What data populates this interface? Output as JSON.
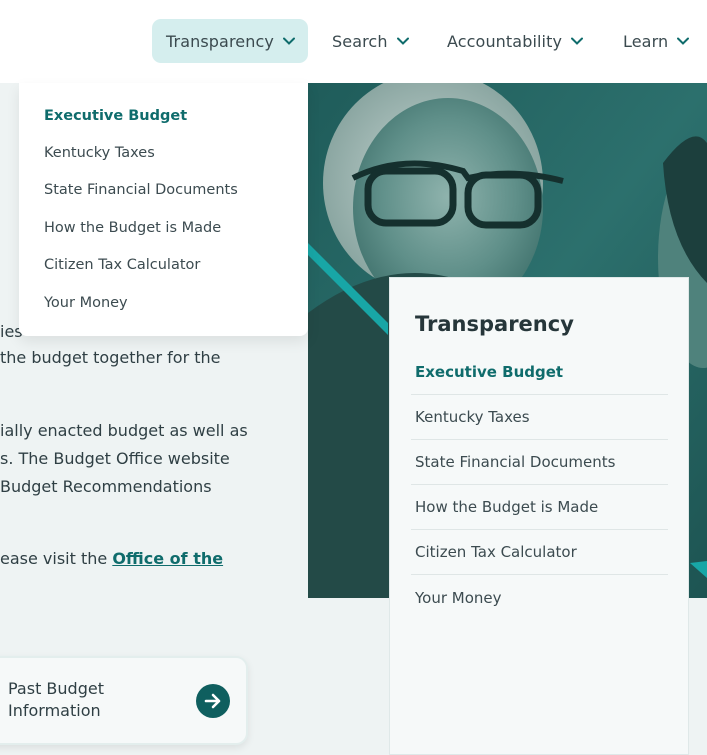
{
  "nav": {
    "items": [
      {
        "label": "Transparency",
        "active": true
      },
      {
        "label": "Search"
      },
      {
        "label": "Accountability"
      },
      {
        "label": "Learn"
      }
    ]
  },
  "dropdown": {
    "items": [
      {
        "label": "Executive Budget",
        "active": true
      },
      {
        "label": "Kentucky Taxes"
      },
      {
        "label": "State Financial Documents"
      },
      {
        "label": "How the Budget is Made"
      },
      {
        "label": "Citizen Tax Calculator"
      },
      {
        "label": "Your Money"
      }
    ]
  },
  "body": {
    "line1": "ies",
    "line2": " the budget together for the",
    "line3": "ially enacted budget as well as",
    "line4": "s. The Budget Office website",
    "line5": " Budget Recommendations",
    "line6_prefix": "ease visit the ",
    "line6_link": "Office of the"
  },
  "past_card": {
    "label_line1": "Past Budget",
    "label_line2": "Information",
    "icon": "arrow-right-icon"
  },
  "sidebar": {
    "title": "Transparency",
    "items": [
      {
        "label": "Executive Budget",
        "active": true
      },
      {
        "label": "Kentucky Taxes"
      },
      {
        "label": "State Financial Documents"
      },
      {
        "label": "How the Budget is Made"
      },
      {
        "label": "Citizen Tax Calculator"
      },
      {
        "label": "Your Money"
      }
    ]
  },
  "colors": {
    "accent": "#0f6c6c",
    "nav_active_bg": "#d5eeee",
    "hero_overlay": "#2a6f6d",
    "diagonal_stripe": "#18a6a6"
  }
}
